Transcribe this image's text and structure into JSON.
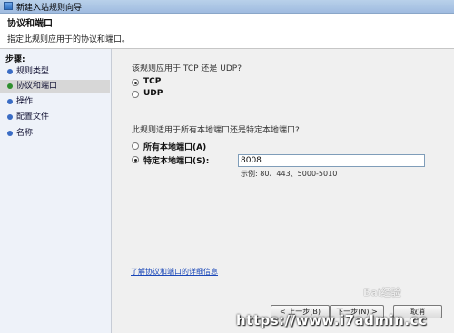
{
  "window": {
    "title": "新建入站规则向导"
  },
  "header": {
    "title": "协议和端口",
    "subtitle": "指定此规则应用于的协议和端口。"
  },
  "steps": {
    "title": "步骤:",
    "items": [
      "规则类型",
      "协议和端口",
      "操作",
      "配置文件",
      "名称"
    ],
    "active_index": 1
  },
  "protocol": {
    "question": "该规则应用于 TCP 还是 UDP?",
    "options": [
      "TCP",
      "UDP"
    ],
    "selected": "TCP"
  },
  "ports": {
    "question": "此规则适用于所有本地端口还是特定本地端口?",
    "options": [
      "所有本地端口(A)",
      "特定本地端口(S):"
    ],
    "selected": "特定本地端口(S):",
    "value": "8008",
    "example": "示例: 80、443、5000-5010"
  },
  "link": {
    "text": "了解协议和端口的详细信息"
  },
  "buttons": {
    "back": "< 上一步(B)",
    "next": "下一步(N) >",
    "cancel": "取消"
  },
  "watermark": {
    "url": "https://www.i7admin.cc",
    "brand": "Bai经验"
  }
}
